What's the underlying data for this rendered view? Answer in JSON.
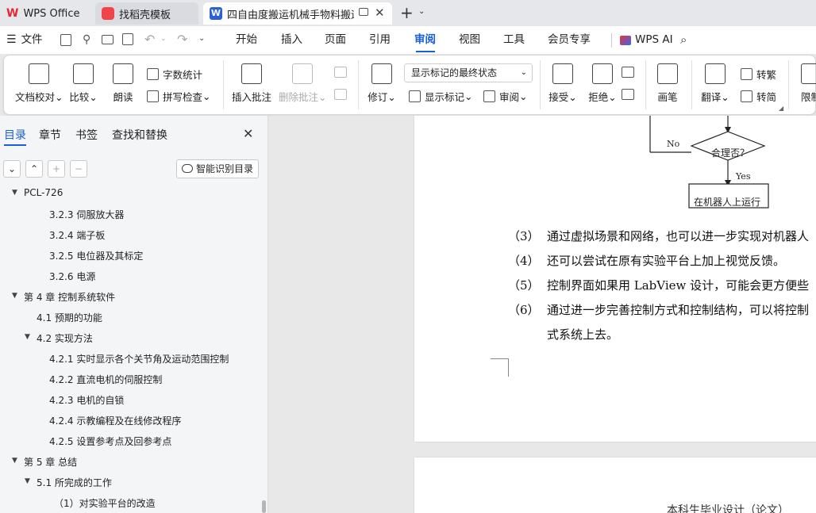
{
  "tabs": [
    {
      "label": "WPS Office",
      "icon": "wps-logo-icon"
    },
    {
      "label": "找稻壳模板",
      "icon": "docer-icon"
    },
    {
      "label": "四自由度搬运机械手物料搬运",
      "icon": "word-doc-icon"
    }
  ],
  "tab_icon_w": "W",
  "menu": {
    "file": "文件",
    "items": [
      "开始",
      "插入",
      "页面",
      "引用",
      "审阅",
      "视图",
      "工具",
      "会员专享"
    ],
    "active": "审阅",
    "wps_ai": "WPS AI"
  },
  "ribbon": {
    "proofread": "文档校对",
    "compare": "比较",
    "read_aloud": "朗读",
    "word_count": "字数统计",
    "spell_check": "拼写检查",
    "insert_comment": "插入批注",
    "delete_comment": "删除批注",
    "track": "修订",
    "markup_select": "显示标记的最终状态",
    "show_markup": "显示标记",
    "review": "审阅",
    "accept": "接受",
    "reject": "拒绝",
    "pen": "画笔",
    "translate": "翻译",
    "to_trad": "转繁",
    "to_simp": "转简",
    "restrict": "限制"
  },
  "panel": {
    "tabs": [
      "目录",
      "章节",
      "书签",
      "查找和替换"
    ],
    "smart_btn": "智能识别目录",
    "toc": [
      {
        "text": "PCL-726",
        "level": 0,
        "arrow": true
      },
      {
        "text": "3.2.3 伺服放大器",
        "level": 2
      },
      {
        "text": "3.2.4 端子板",
        "level": 2
      },
      {
        "text": "3.2.5 电位器及其标定",
        "level": 2
      },
      {
        "text": "3.2.6 电源",
        "level": 2
      },
      {
        "text": "第 4 章  控制系统软件",
        "level": 0,
        "arrow": true
      },
      {
        "text": "4.1 预期的功能",
        "level": 1
      },
      {
        "text": "4.2  实现方法",
        "level": 1,
        "arrow": true
      },
      {
        "text": "4.2.1 实时显示各个关节角及运动范围控制",
        "level": 2
      },
      {
        "text": "4.2.2 直流电机的伺服控制",
        "level": 2
      },
      {
        "text": "4.2.3 电机的自锁",
        "level": 2
      },
      {
        "text": "4.2.4 示教编程及在线修改程序",
        "level": 2
      },
      {
        "text": "4.2.5 设置参考点及回参考点",
        "level": 2
      },
      {
        "text": "第 5 章  总结",
        "level": 0,
        "arrow": true
      },
      {
        "text": "5.1  所完成的工作",
        "level": 1,
        "arrow": true
      },
      {
        "text": "（1）对实验平台的改造",
        "level": 3
      }
    ]
  },
  "doc": {
    "flow": {
      "no": "No",
      "decision": "合理否？",
      "yes": "Yes",
      "box": "在机器人上运行"
    },
    "paras": [
      {
        "num": "（3）",
        "text": "通过虚拟场景和网络，也可以进一步实现对机器人"
      },
      {
        "num": "（4）",
        "text": "还可以尝试在原有实验平台上加上视觉反馈。"
      },
      {
        "num": "（5）",
        "text": "控制界面如果用 LabView 设计，可能会更方便些"
      },
      {
        "num": "（6）",
        "text": "通过进一步完善控制方式和控制结构，可以将控制"
      },
      {
        "num": "",
        "text": "式系统上去。"
      }
    ],
    "next_header": "本科生毕业设计（论文）"
  },
  "colors": {
    "accent": "#1a5fd6",
    "wps_red": "#e8262f",
    "docer_red": "#f0444a",
    "word_blue": "#2b5fe0"
  }
}
